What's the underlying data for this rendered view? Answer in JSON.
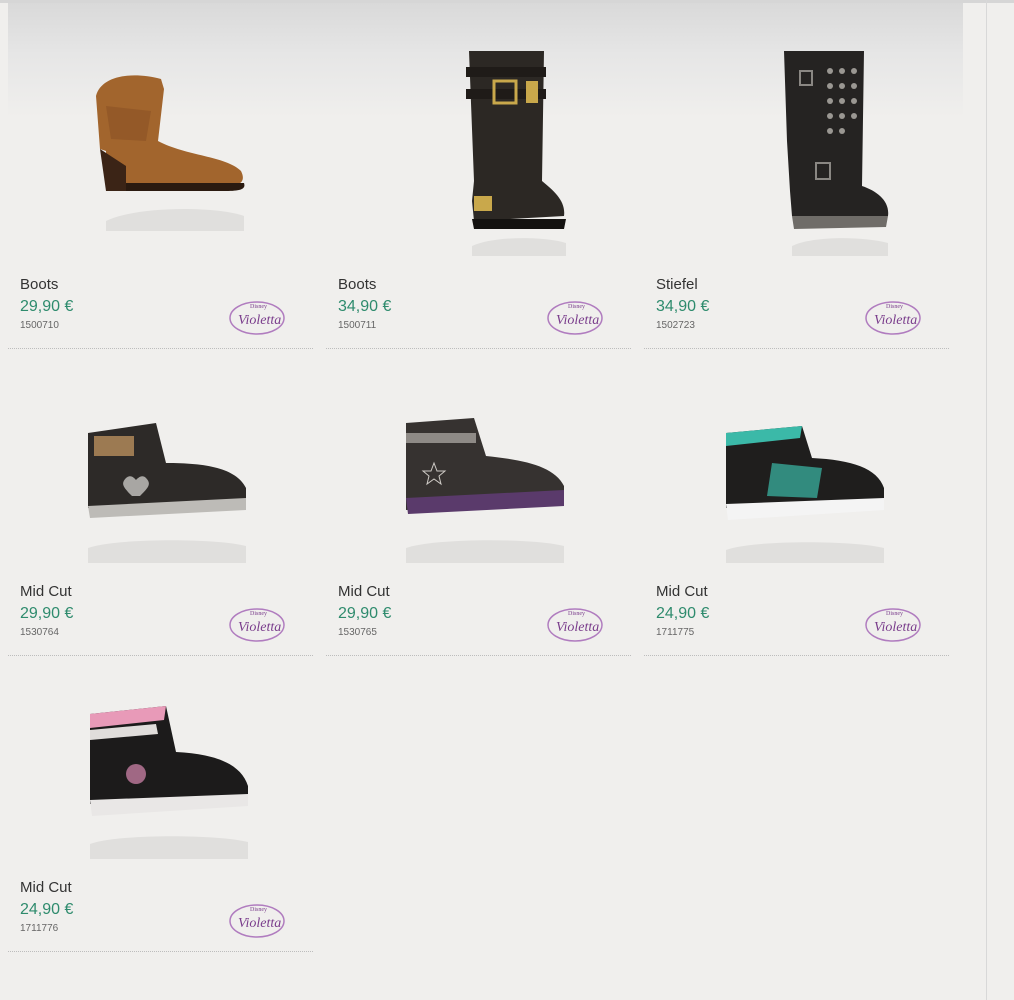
{
  "products": [
    {
      "name": "Boots",
      "price": "29,90 €",
      "sku": "1500710",
      "brand": "Disney Violetta",
      "image": "brown-western-ankle-boot"
    },
    {
      "name": "Boots",
      "price": "34,90 €",
      "sku": "1500711",
      "brand": "Disney Violetta",
      "image": "black-lace-up-buckle-boot"
    },
    {
      "name": "Stiefel",
      "price": "34,90 €",
      "sku": "1502723",
      "brand": "Disney Violetta",
      "image": "black-studded-biker-boot"
    },
    {
      "name": "Mid Cut",
      "price": "29,90 €",
      "sku": "1530764",
      "brand": "Disney Violetta",
      "image": "black-heart-sneaker"
    },
    {
      "name": "Mid Cut",
      "price": "29,90 €",
      "sku": "1530765",
      "brand": "Disney Violetta",
      "image": "black-star-sneaker"
    },
    {
      "name": "Mid Cut",
      "price": "24,90 €",
      "sku": "1711775",
      "brand": "Disney Violetta",
      "image": "black-turquoise-sneaker"
    },
    {
      "name": "Mid Cut",
      "price": "24,90 €",
      "sku": "1711776",
      "brand": "Disney Violetta",
      "image": "black-pink-sneaker"
    }
  ],
  "logo": {
    "top": "Disney",
    "main": "Violetta"
  },
  "colors": {
    "price": "#2e8b6d",
    "logo": "#7a3d8c",
    "background": "#f0efed"
  }
}
